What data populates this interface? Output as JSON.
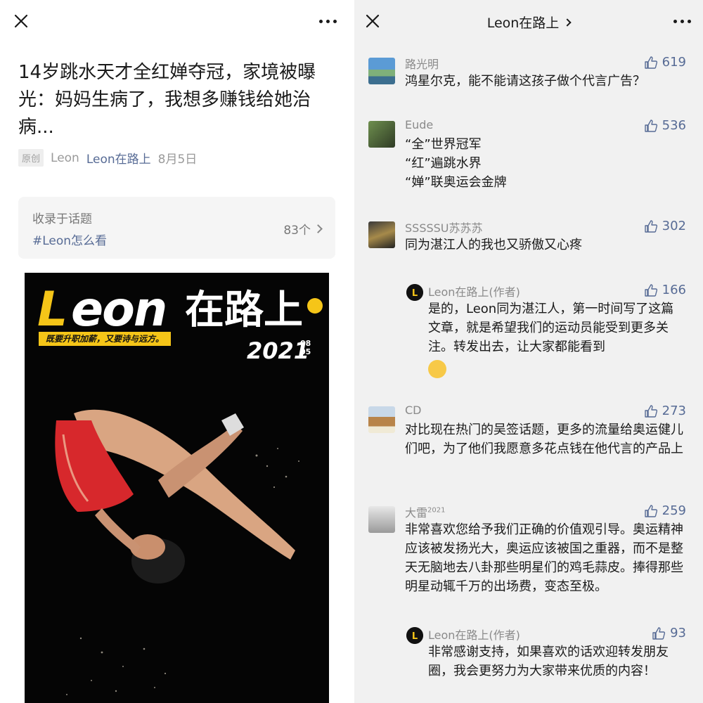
{
  "left": {
    "title": "14岁跳水天才全红婵夺冠，家境被曝光：妈妈生病了，我想多赚钱给她治病...",
    "meta": {
      "badge": "原创",
      "author": "Leon",
      "account": "Leon在路上",
      "date": "8月5日"
    },
    "topic": {
      "label": "收录于话题",
      "tag": "#Leon怎么看",
      "count": "83个"
    },
    "cover": {
      "logo_l": "L",
      "logo_eon": "eon",
      "logo_cn": "在路上",
      "slogan": "既要升职加薪，又要诗与远方。",
      "year": "2021",
      "month": "08",
      "day": "05"
    }
  },
  "right": {
    "header_title": "Leon在路上",
    "comments": [
      {
        "name": "路光明",
        "likes": "619",
        "text": "鸿星尔克，能不能请这孩子做个代言广告？"
      },
      {
        "name": "Eude",
        "likes": "536",
        "lines": [
          "“全”世界冠军",
          "“红”遍跳水界",
          "“婵”联奥运会金牌"
        ]
      },
      {
        "name": "SSSSSU苏苏苏",
        "likes": "302",
        "text": "同为湛江人的我也又骄傲又心疼"
      },
      {
        "name": "Leon在路上(作者)",
        "likes": "166",
        "text": "是的，Leon同为湛江人，第一时间写了这篇文章，就是希望我们的运动员能受到更多关注。转发出去，让大家都能看到"
      },
      {
        "name": "CD",
        "likes": "273",
        "text": "对比现在热门的吴签话题，更多的流量给奥运健儿们吧，为了他们我愿意多花点钱在他代言的产品上"
      },
      {
        "name": "大雷",
        "name_sup": "2021",
        "likes": "259",
        "text": "非常喜欢您给予我们正确的价值观引导。奥运精神应该被发扬光大，奥运应该被国之重器，而不是整天无脑地去八卦那些明星们的鸡毛蒜皮。捧得那些明星动辄千万的出场费，变态至极。"
      },
      {
        "name": "Leon在路上(作者)",
        "likes": "93",
        "text": "非常感谢支持，如果喜欢的话欢迎转发朋友圈，我会更努力为大家带来优质的内容！"
      }
    ]
  },
  "colors": {
    "link": "#576b95",
    "cover_yellow": "#f5c518",
    "panel_gray": "#f1f1f1"
  }
}
